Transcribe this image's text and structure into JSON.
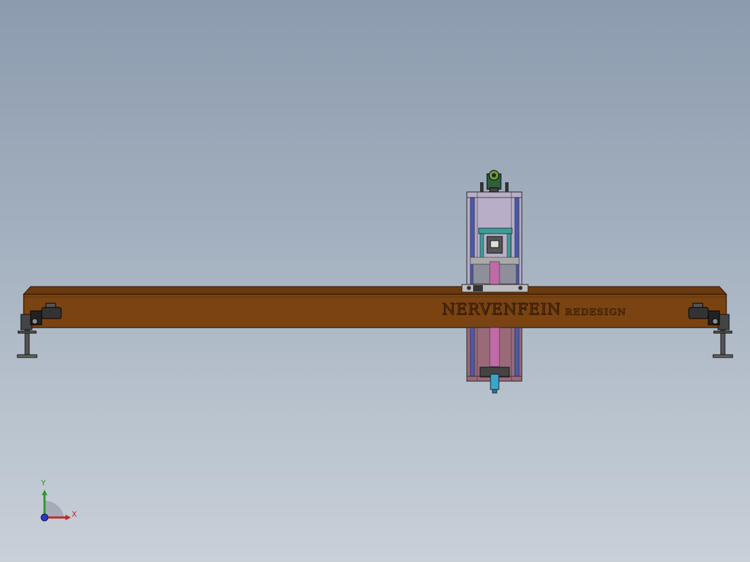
{
  "model": {
    "brand_text": "NERVENFEIN",
    "subtitle_text": "REDESIGN"
  },
  "triad": {
    "y_label": "Y",
    "x_label": "X"
  },
  "colors": {
    "background_top": "#8c9bae",
    "background_bottom": "#c8d0d8",
    "beam": "#7a4412",
    "beam_edge": "#2b1505",
    "carriage_top": "#b8aec8",
    "carriage_bottom": "#9a6a78",
    "accent_cyan": "#3aa7c9",
    "accent_teal": "#3e9e94",
    "axis_x": "#c0282a",
    "axis_y": "#2a9a2a",
    "axis_z": "#2a3ac0"
  },
  "icons": [
    "gantry-crane-model",
    "view-triad-icon"
  ]
}
